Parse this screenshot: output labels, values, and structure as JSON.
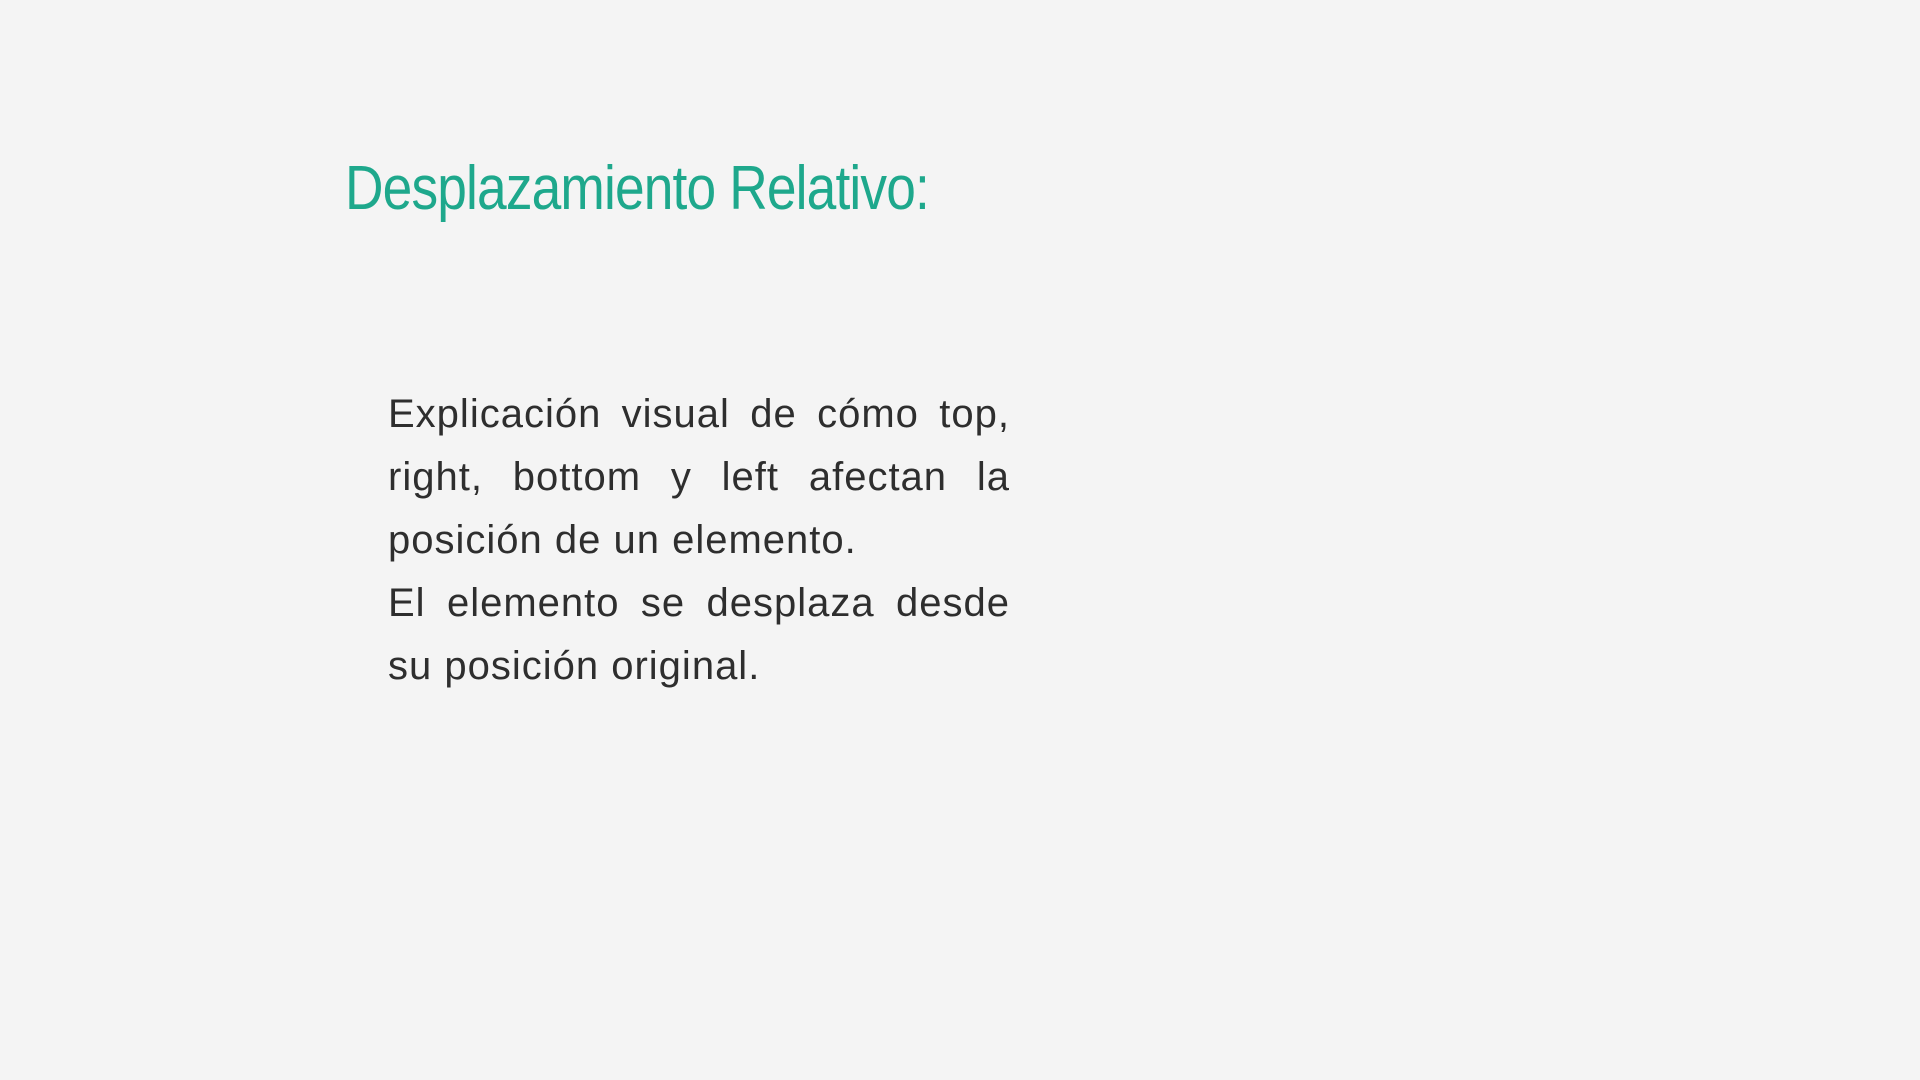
{
  "slide": {
    "title": "Desplazamiento Relativo:",
    "paragraphs": [
      "Explicación visual de cómo top, right, bottom y left afectan la posición de un elemento.",
      "El elemento se desplaza desde su posición original."
    ]
  },
  "colors": {
    "background": "#f4f4f4",
    "title": "#1ea88c",
    "body_text": "#2e2e2e"
  }
}
